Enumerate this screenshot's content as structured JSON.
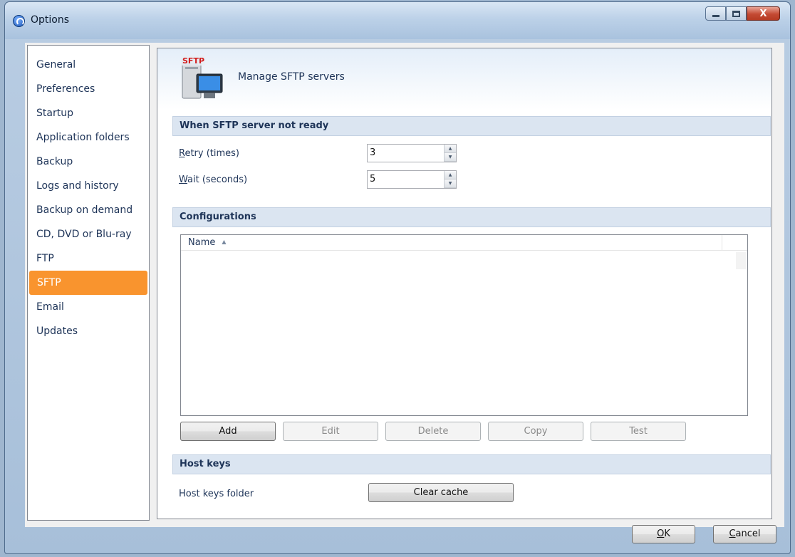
{
  "window": {
    "title": "Options",
    "controls": {
      "minimize": "minimize-icon",
      "maximize": "maximize-icon",
      "close": "X"
    }
  },
  "nav": {
    "items": [
      {
        "label": "General"
      },
      {
        "label": "Preferences"
      },
      {
        "label": "Startup"
      },
      {
        "label": "Application folders"
      },
      {
        "label": "Backup"
      },
      {
        "label": "Logs and history"
      },
      {
        "label": "Backup on demand"
      },
      {
        "label": "CD, DVD or Blu-ray"
      },
      {
        "label": "FTP"
      },
      {
        "label": "SFTP",
        "selected": true
      },
      {
        "label": "Email"
      },
      {
        "label": "Updates"
      }
    ],
    "active_color": "#f9942e"
  },
  "header": {
    "icon_label": "SFTP",
    "title": "Manage SFTP servers"
  },
  "sections": {
    "not_ready": {
      "title": "When SFTP server not ready",
      "retry": {
        "label_key": "R",
        "label_rest": "etry (times)",
        "value": "3"
      },
      "wait": {
        "label_key": "W",
        "label_rest": "ait (seconds)",
        "value": "5"
      }
    },
    "configurations": {
      "title": "Configurations",
      "list": {
        "columns": [
          "Name"
        ],
        "sort": "ascending",
        "rows": []
      },
      "buttons": {
        "add": "Add",
        "edit": "Edit",
        "delete": "Delete",
        "copy": "Copy",
        "test": "Test"
      }
    },
    "host_keys": {
      "title": "Host keys",
      "folder_label": "Host keys folder",
      "clear_cache": "Clear cache"
    }
  },
  "footer": {
    "ok_key": "O",
    "ok_rest": "K",
    "cancel_key": "C",
    "cancel_rest": "ancel"
  }
}
